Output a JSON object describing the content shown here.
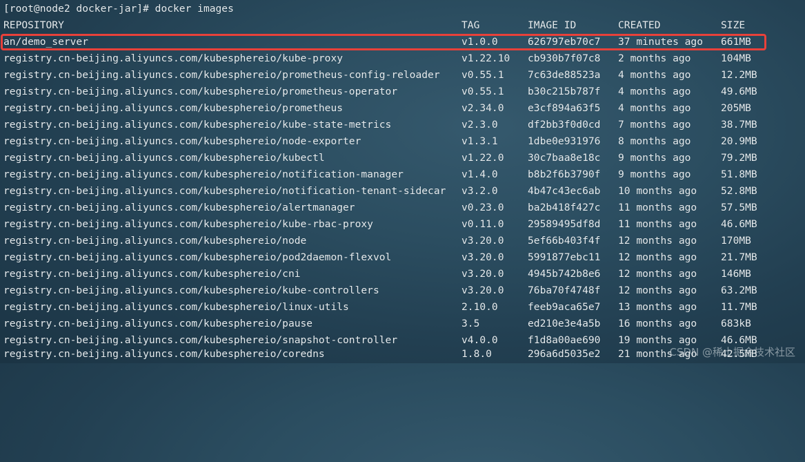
{
  "terminal": {
    "prompt": "[root@node2 docker-jar]# docker images",
    "headers": {
      "repository": "REPOSITORY",
      "tag": "TAG",
      "image_id": "IMAGE ID",
      "created": "CREATED",
      "size": "SIZE"
    },
    "rows": [
      {
        "repository": "an/demo_server",
        "tag": "v1.0.0",
        "image_id": "626797eb70c7",
        "created": "37 minutes ago",
        "size": "661MB"
      },
      {
        "repository": "registry.cn-beijing.aliyuncs.com/kubesphereio/kube-proxy",
        "tag": "v1.22.10",
        "image_id": "cb930b7f07c8",
        "created": "2 months ago",
        "size": "104MB"
      },
      {
        "repository": "registry.cn-beijing.aliyuncs.com/kubesphereio/prometheus-config-reloader",
        "tag": "v0.55.1",
        "image_id": "7c63de88523a",
        "created": "4 months ago",
        "size": "12.2MB"
      },
      {
        "repository": "registry.cn-beijing.aliyuncs.com/kubesphereio/prometheus-operator",
        "tag": "v0.55.1",
        "image_id": "b30c215b787f",
        "created": "4 months ago",
        "size": "49.6MB"
      },
      {
        "repository": "registry.cn-beijing.aliyuncs.com/kubesphereio/prometheus",
        "tag": "v2.34.0",
        "image_id": "e3cf894a63f5",
        "created": "4 months ago",
        "size": "205MB"
      },
      {
        "repository": "registry.cn-beijing.aliyuncs.com/kubesphereio/kube-state-metrics",
        "tag": "v2.3.0",
        "image_id": "df2bb3f0d0cd",
        "created": "7 months ago",
        "size": "38.7MB"
      },
      {
        "repository": "registry.cn-beijing.aliyuncs.com/kubesphereio/node-exporter",
        "tag": "v1.3.1",
        "image_id": "1dbe0e931976",
        "created": "8 months ago",
        "size": "20.9MB"
      },
      {
        "repository": "registry.cn-beijing.aliyuncs.com/kubesphereio/kubectl",
        "tag": "v1.22.0",
        "image_id": "30c7baa8e18c",
        "created": "9 months ago",
        "size": "79.2MB"
      },
      {
        "repository": "registry.cn-beijing.aliyuncs.com/kubesphereio/notification-manager",
        "tag": "v1.4.0",
        "image_id": "b8b2f6b3790f",
        "created": "9 months ago",
        "size": "51.8MB"
      },
      {
        "repository": "registry.cn-beijing.aliyuncs.com/kubesphereio/notification-tenant-sidecar",
        "tag": "v3.2.0",
        "image_id": "4b47c43ec6ab",
        "created": "10 months ago",
        "size": "52.8MB"
      },
      {
        "repository": "registry.cn-beijing.aliyuncs.com/kubesphereio/alertmanager",
        "tag": "v0.23.0",
        "image_id": "ba2b418f427c",
        "created": "11 months ago",
        "size": "57.5MB"
      },
      {
        "repository": "registry.cn-beijing.aliyuncs.com/kubesphereio/kube-rbac-proxy",
        "tag": "v0.11.0",
        "image_id": "29589495df8d",
        "created": "11 months ago",
        "size": "46.6MB"
      },
      {
        "repository": "registry.cn-beijing.aliyuncs.com/kubesphereio/node",
        "tag": "v3.20.0",
        "image_id": "5ef66b403f4f",
        "created": "12 months ago",
        "size": "170MB"
      },
      {
        "repository": "registry.cn-beijing.aliyuncs.com/kubesphereio/pod2daemon-flexvol",
        "tag": "v3.20.0",
        "image_id": "5991877ebc11",
        "created": "12 months ago",
        "size": "21.7MB"
      },
      {
        "repository": "registry.cn-beijing.aliyuncs.com/kubesphereio/cni",
        "tag": "v3.20.0",
        "image_id": "4945b742b8e6",
        "created": "12 months ago",
        "size": "146MB"
      },
      {
        "repository": "registry.cn-beijing.aliyuncs.com/kubesphereio/kube-controllers",
        "tag": "v3.20.0",
        "image_id": "76ba70f4748f",
        "created": "12 months ago",
        "size": "63.2MB"
      },
      {
        "repository": "registry.cn-beijing.aliyuncs.com/kubesphereio/linux-utils",
        "tag": "2.10.0",
        "image_id": "feeb9aca65e7",
        "created": "13 months ago",
        "size": "11.7MB"
      },
      {
        "repository": "registry.cn-beijing.aliyuncs.com/kubesphereio/pause",
        "tag": "3.5",
        "image_id": "ed210e3e4a5b",
        "created": "16 months ago",
        "size": "683kB"
      },
      {
        "repository": "registry.cn-beijing.aliyuncs.com/kubesphereio/snapshot-controller",
        "tag": "v4.0.0",
        "image_id": "f1d8a00ae690",
        "created": "19 months ago",
        "size": "46.6MB"
      },
      {
        "repository": "registry.cn-beijing.aliyuncs.com/kubesphereio/coredns",
        "tag": "1.8.0",
        "image_id": "296a6d5035e2",
        "created": "21 months ago",
        "size": "42.5MB"
      }
    ]
  },
  "watermark": "CSDN @稀土掘金技术社区",
  "colors": {
    "highlight": "#e8413a",
    "text": "#e6ecef"
  }
}
